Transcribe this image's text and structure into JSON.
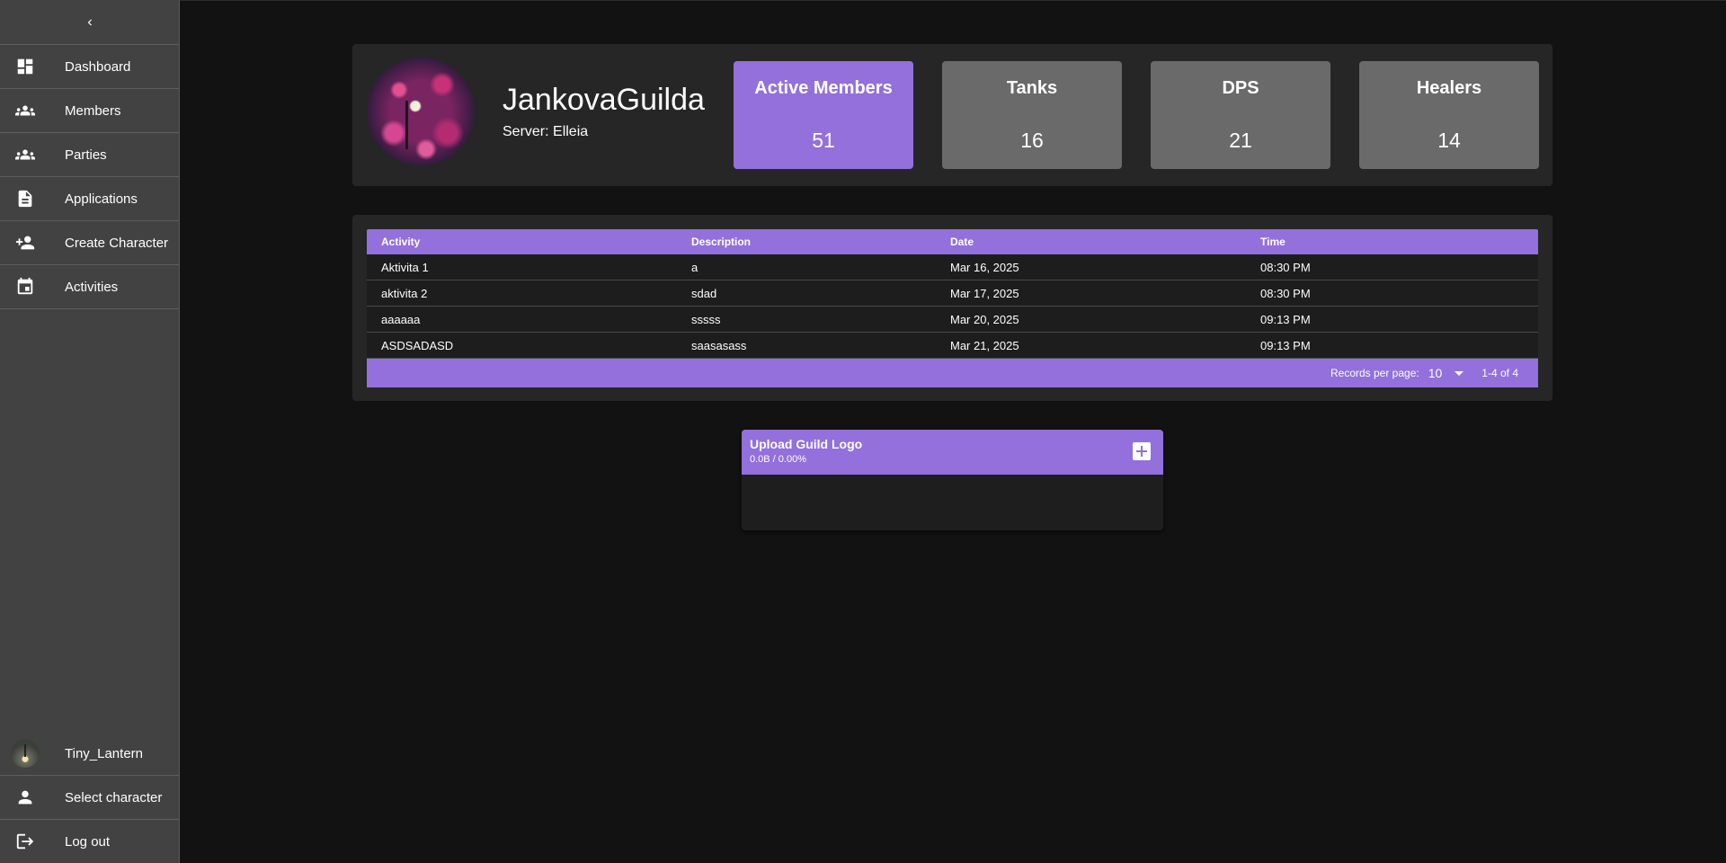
{
  "sidebar": {
    "collapse_icon": "chevron-left-icon",
    "items": [
      {
        "label": "Dashboard",
        "icon": "dashboard-icon"
      },
      {
        "label": "Members",
        "icon": "group-icon"
      },
      {
        "label": "Parties",
        "icon": "group-icon"
      },
      {
        "label": "Applications",
        "icon": "document-icon"
      },
      {
        "label": "Create Character",
        "icon": "person-add-icon"
      },
      {
        "label": "Activities",
        "icon": "calendar-icon"
      }
    ],
    "bottom": {
      "user_name": "Tiny_Lantern",
      "select_character": "Select character",
      "logout": "Log out"
    }
  },
  "guild": {
    "name": "JankovaGuilda",
    "server": "Server: Elleia"
  },
  "stats": [
    {
      "label": "Active Members",
      "value": "51",
      "color": "#9370db"
    },
    {
      "label": "Tanks",
      "value": "16",
      "color": "#6a6a6a"
    },
    {
      "label": "DPS",
      "value": "21",
      "color": "#6a6a6a"
    },
    {
      "label": "Healers",
      "value": "14",
      "color": "#6a6a6a"
    }
  ],
  "activities_table": {
    "columns": [
      "Activity",
      "Description",
      "Date",
      "Time"
    ],
    "rows": [
      [
        "Aktivita 1",
        "a",
        "Mar 16, 2025",
        "08:30 PM"
      ],
      [
        "aktivita 2",
        "sdad",
        "Mar 17, 2025",
        "08:30 PM"
      ],
      [
        "aaaaaa",
        "sssss",
        "Mar 20, 2025",
        "09:13 PM"
      ],
      [
        "ASDSADASD",
        "saasasass",
        "Mar 21, 2025",
        "09:13 PM"
      ]
    ],
    "records_per_page_label": "Records per page:",
    "records_per_page": "10",
    "range": "1-4 of 4"
  },
  "upload": {
    "title": "Upload Guild Logo",
    "progress": "0.0B / 0.00%",
    "add_icon": "plus-box-icon"
  },
  "colors": {
    "accent": "#9370db",
    "background": "#121212",
    "sidebar": "#424242",
    "card": "#262626"
  }
}
